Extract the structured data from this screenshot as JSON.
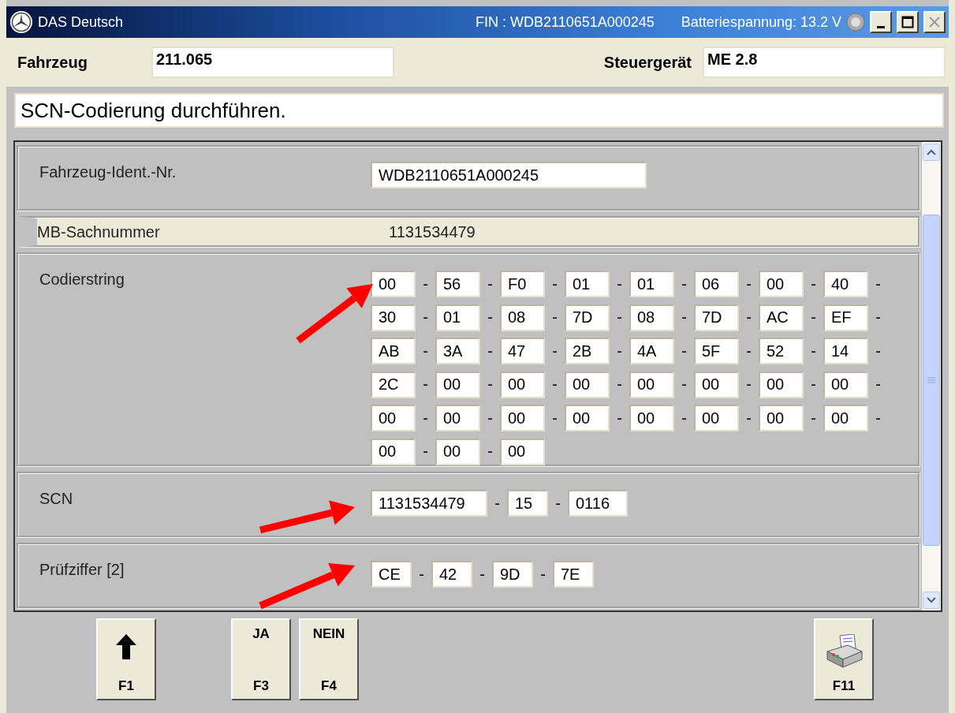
{
  "window": {
    "title": "DAS Deutsch",
    "fin": "FIN : WDB2110651A000245",
    "battery": "Batteriespannung: 13.2 V"
  },
  "header": {
    "vehicle_label": "Fahrzeug",
    "vehicle_value": "211.065",
    "ecu_label": "Steuergerät",
    "ecu_value": "ME 2.8"
  },
  "message": "SCN-Codierung durchführen.",
  "rows": [
    {
      "kind": "field",
      "label": "Fahrzeug-Ident.-Nr.",
      "value": "WDB2110651A000245"
    },
    {
      "kind": "info",
      "label": "MB-Sachnummer",
      "value": "1131534479"
    },
    {
      "kind": "codes",
      "label": "Codierstring",
      "separator": "-",
      "values": [
        "00",
        "56",
        "F0",
        "01",
        "01",
        "06",
        "00",
        "40",
        "30",
        "01",
        "08",
        "7D",
        "08",
        "7D",
        "AC",
        "EF",
        "AB",
        "3A",
        "47",
        "2B",
        "4A",
        "5F",
        "52",
        "14",
        "2C",
        "00",
        "00",
        "00",
        "00",
        "00",
        "00",
        "00",
        "00",
        "00",
        "00",
        "00",
        "00",
        "00",
        "00",
        "00",
        "00",
        "00",
        "00"
      ]
    },
    {
      "kind": "segments",
      "label": "SCN",
      "separator": "-",
      "values": [
        "1131534479",
        "15",
        "0116"
      ]
    },
    {
      "kind": "segments",
      "label": "Prüfziffer [2]",
      "separator": "-",
      "values": [
        "CE",
        "42",
        "9D",
        "7E"
      ]
    }
  ],
  "buttons": [
    {
      "kind": "up",
      "key": "F1"
    },
    {
      "kind": "text",
      "label": "JA",
      "key": "F3"
    },
    {
      "kind": "text",
      "label": "NEIN",
      "key": "F4"
    },
    {
      "kind": "print",
      "key": "F11"
    }
  ]
}
